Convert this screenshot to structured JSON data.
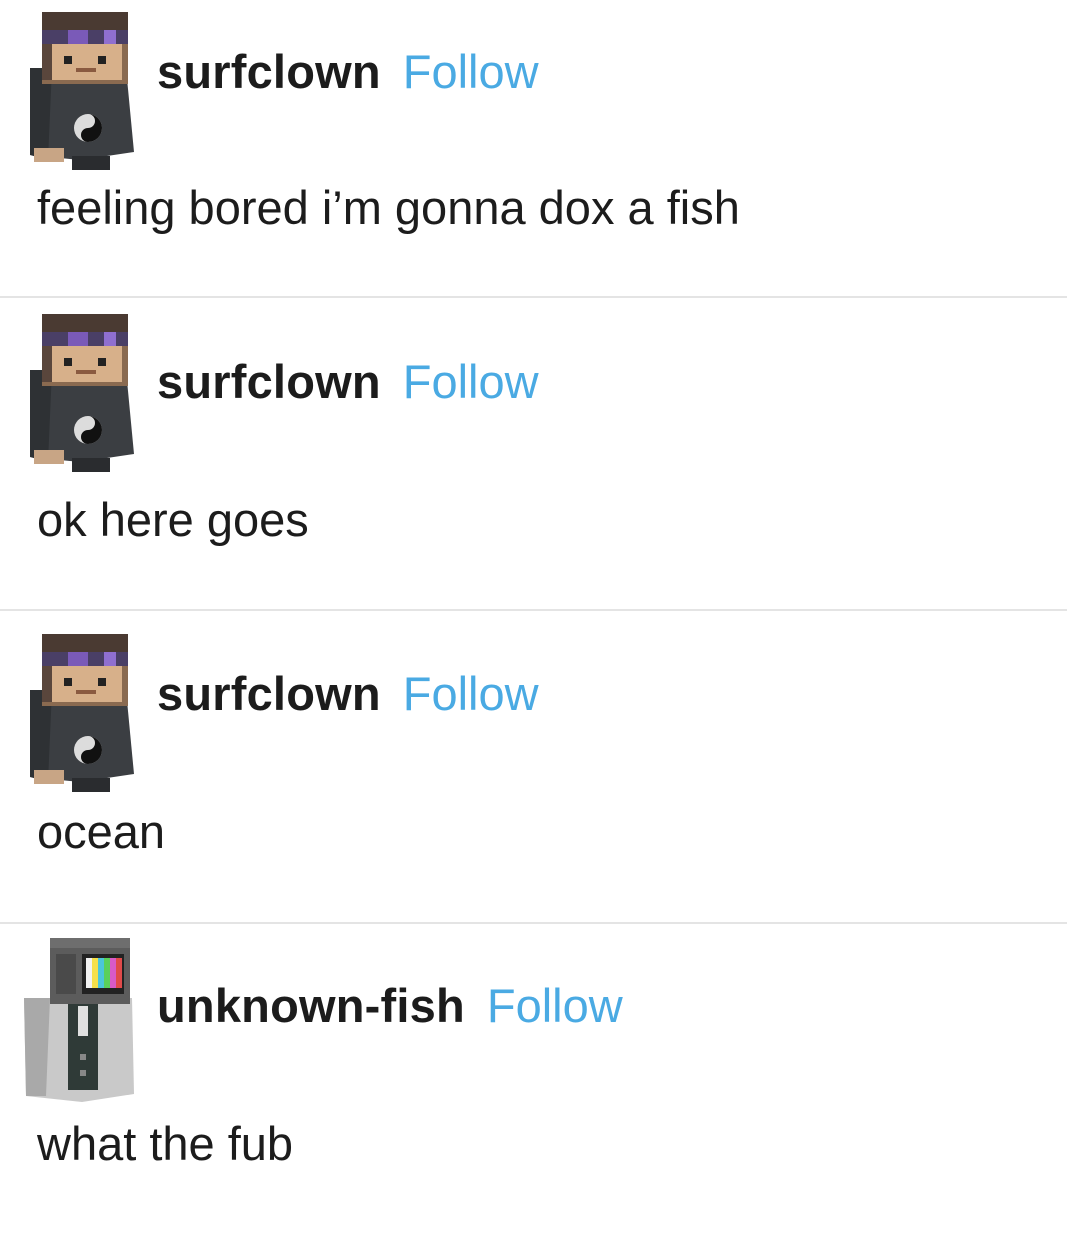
{
  "posts": [
    {
      "username": "surfclown",
      "follow_label": "Follow",
      "avatar_icon": "minecraft-skin-headband-avatar",
      "text": "feeling bored i’m gonna dox a fish"
    },
    {
      "username": "surfclown",
      "follow_label": "Follow",
      "avatar_icon": "minecraft-skin-headband-avatar",
      "text": "ok here goes"
    },
    {
      "username": "surfclown",
      "follow_label": "Follow",
      "avatar_icon": "minecraft-skin-headband-avatar",
      "text": "ocean"
    },
    {
      "username": "unknown-fish",
      "follow_label": "Follow",
      "avatar_icon": "minecraft-skin-tv-head-avatar",
      "text": "what the fub"
    }
  ],
  "colors": {
    "follow_link": "#4aaae3",
    "text": "#1c1c1c",
    "divider": "#e4e4e4",
    "background": "#ffffff"
  }
}
